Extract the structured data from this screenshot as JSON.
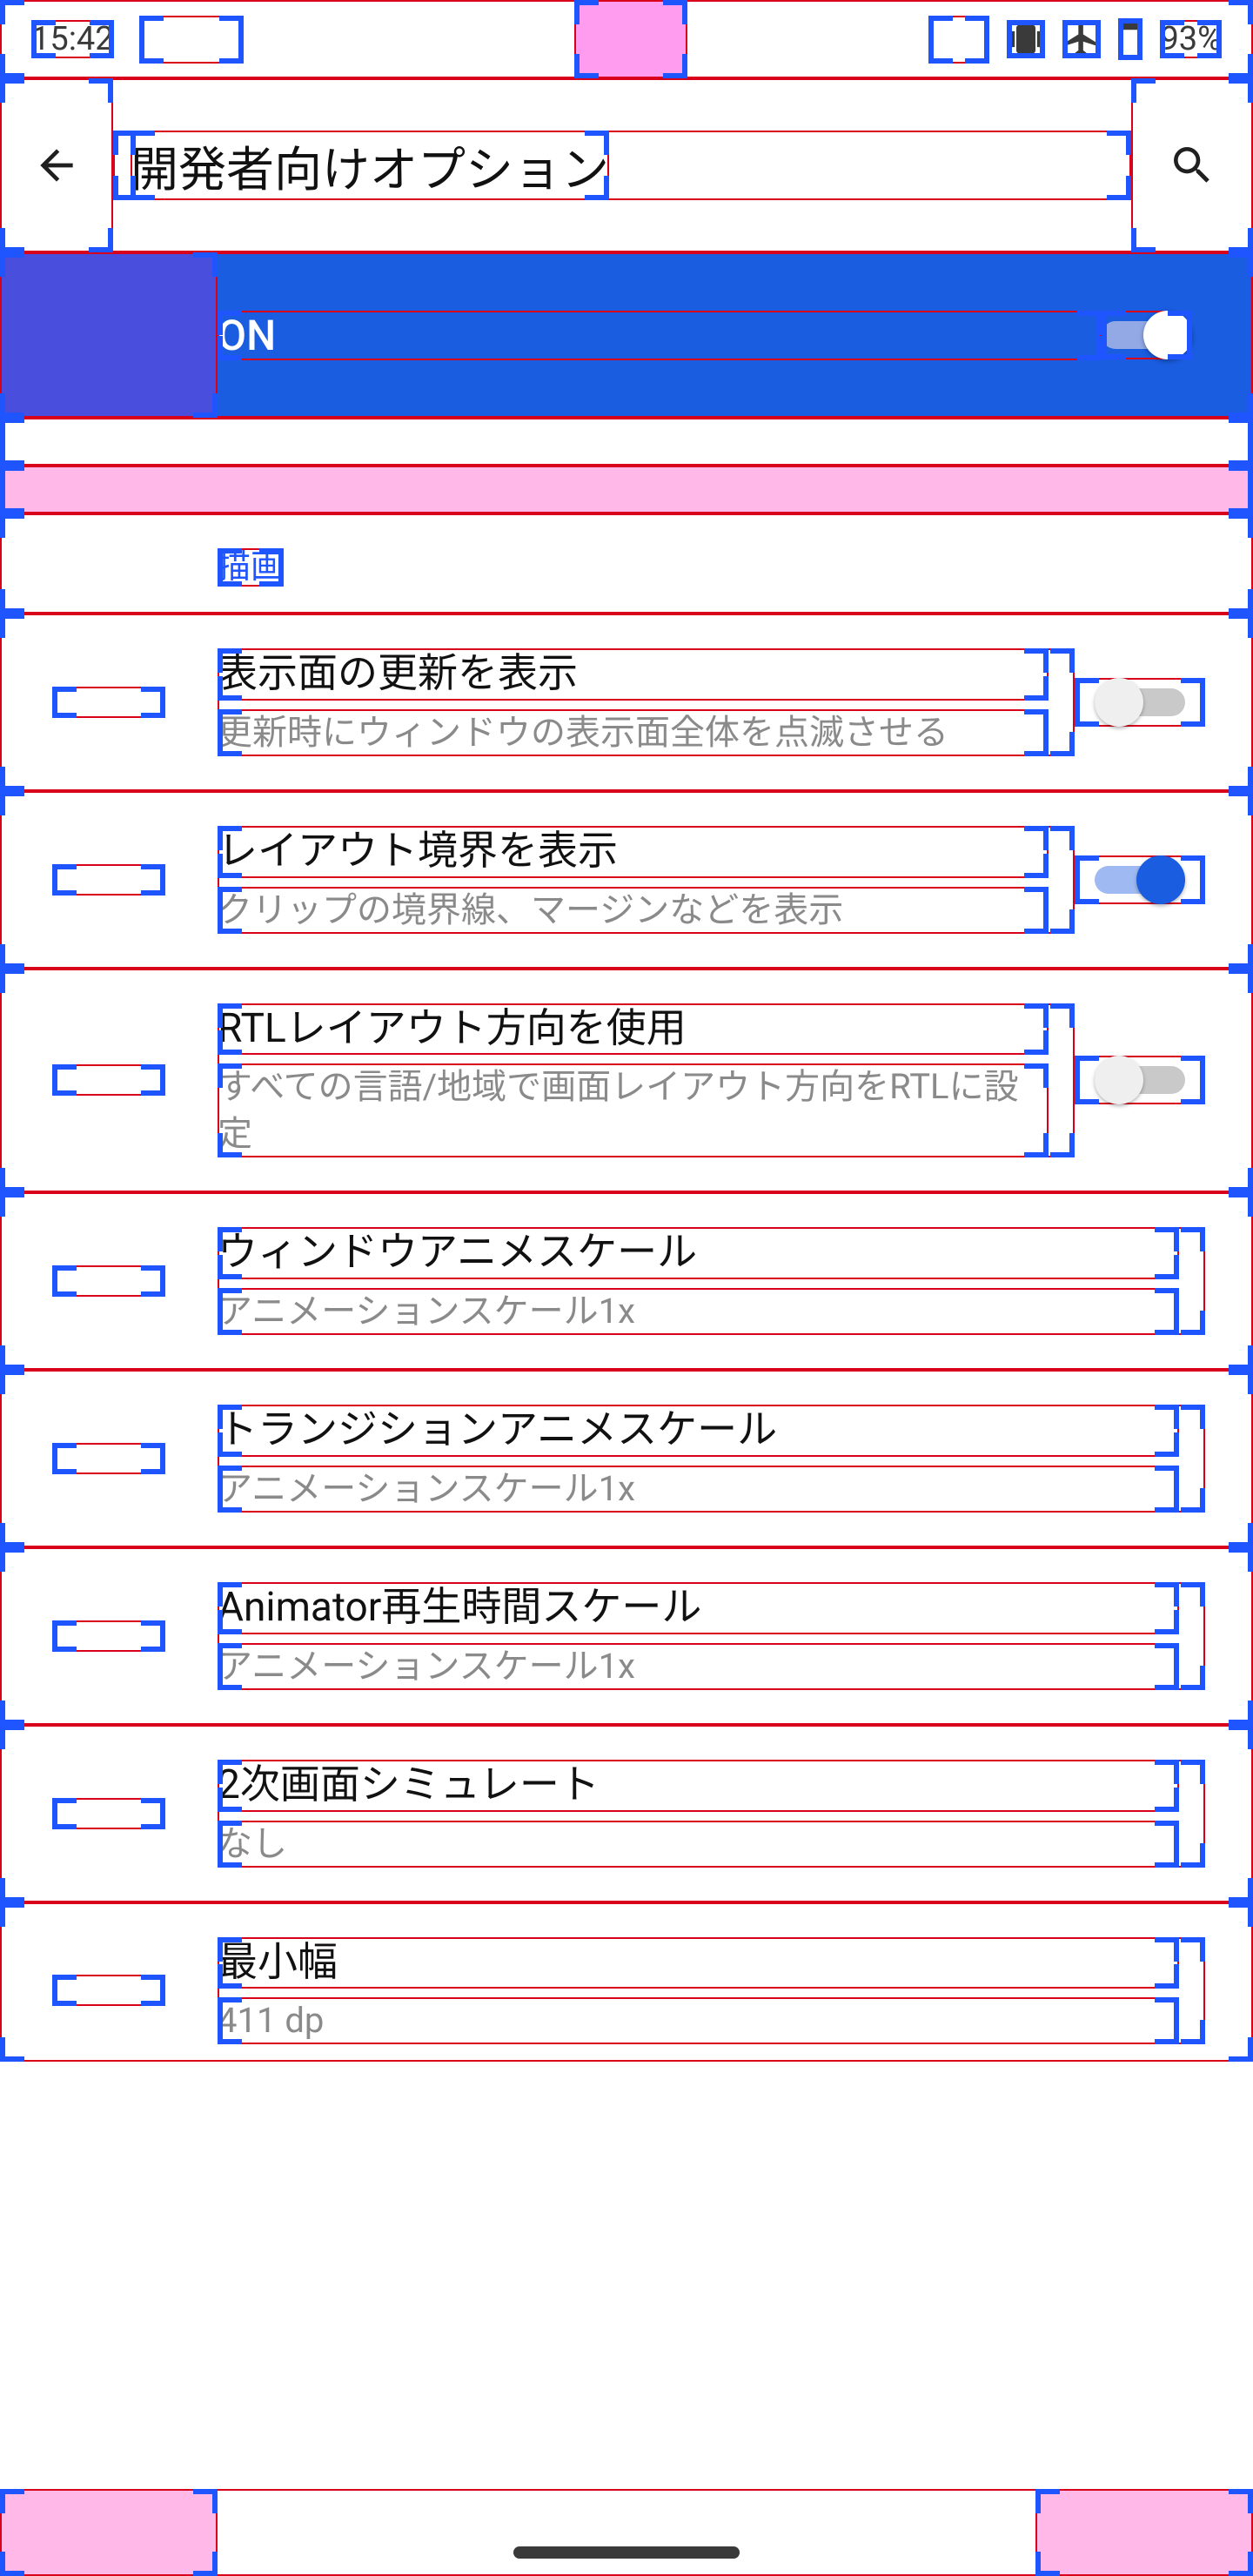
{
  "statusbar": {
    "time": "15:42",
    "battery": "93%"
  },
  "appbar": {
    "title": "開発者向けオプション"
  },
  "master_switch": {
    "label": "ON",
    "state": "on"
  },
  "section": {
    "drawing": "描画"
  },
  "rows": [
    {
      "title": "表示面の更新を表示",
      "sub": "更新時にウィンドウの表示面全体を点滅させる",
      "switch": "off"
    },
    {
      "title": "レイアウト境界を表示",
      "sub": "クリップの境界線、マージンなどを表示",
      "switch": "on"
    },
    {
      "title": "RTLレイアウト方向を使用",
      "sub": "すべての言語/地域で画面レイアウト方向をRTLに設定",
      "switch": "off"
    },
    {
      "title": "ウィンドウアニメスケール",
      "sub": "アニメーションスケール1x"
    },
    {
      "title": "トランジションアニメスケール",
      "sub": "アニメーションスケール1x"
    },
    {
      "title": "Animator再生時間スケール",
      "sub": "アニメーションスケール1x"
    },
    {
      "title": "2次画面シミュレート",
      "sub": "なし"
    },
    {
      "title": "最小幅",
      "sub": "411 dp"
    }
  ]
}
